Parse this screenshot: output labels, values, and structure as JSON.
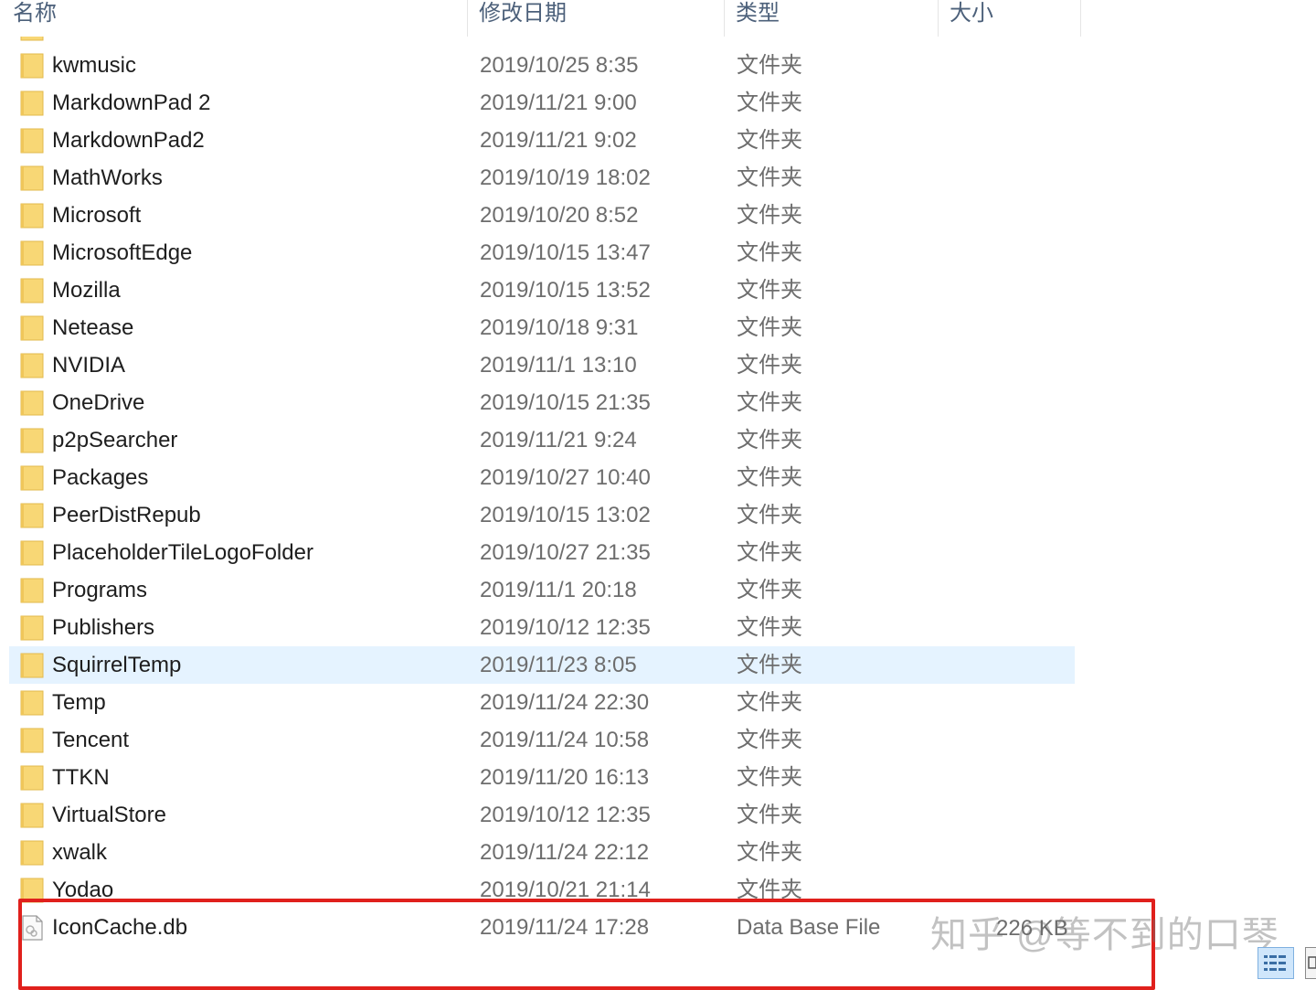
{
  "columns": {
    "name": "名称",
    "date": "修改日期",
    "type": "类型",
    "size": "大小"
  },
  "rows": [
    {
      "name": "kwmusic",
      "date": "2019/10/25 8:35",
      "type": "文件夹",
      "icon": "folder-icon"
    },
    {
      "name": "MarkdownPad 2",
      "date": "2019/11/21 9:00",
      "type": "文件夹",
      "icon": "folder-icon"
    },
    {
      "name": "MarkdownPad2",
      "date": "2019/11/21 9:02",
      "type": "文件夹",
      "icon": "folder-icon"
    },
    {
      "name": "MathWorks",
      "date": "2019/10/19 18:02",
      "type": "文件夹",
      "icon": "folder-icon"
    },
    {
      "name": "Microsoft",
      "date": "2019/10/20 8:52",
      "type": "文件夹",
      "icon": "folder-icon"
    },
    {
      "name": "MicrosoftEdge",
      "date": "2019/10/15 13:47",
      "type": "文件夹",
      "icon": "folder-icon"
    },
    {
      "name": "Mozilla",
      "date": "2019/10/15 13:52",
      "type": "文件夹",
      "icon": "folder-icon"
    },
    {
      "name": "Netease",
      "date": "2019/10/18 9:31",
      "type": "文件夹",
      "icon": "folder-icon"
    },
    {
      "name": "NVIDIA",
      "date": "2019/11/1 13:10",
      "type": "文件夹",
      "icon": "folder-icon"
    },
    {
      "name": "OneDrive",
      "date": "2019/10/15 21:35",
      "type": "文件夹",
      "icon": "folder-icon"
    },
    {
      "name": "p2pSearcher",
      "date": "2019/11/21 9:24",
      "type": "文件夹",
      "icon": "folder-icon"
    },
    {
      "name": "Packages",
      "date": "2019/10/27 10:40",
      "type": "文件夹",
      "icon": "folder-icon"
    },
    {
      "name": "PeerDistRepub",
      "date": "2019/10/15 13:02",
      "type": "文件夹",
      "icon": "folder-icon"
    },
    {
      "name": "PlaceholderTileLogoFolder",
      "date": "2019/10/27 21:35",
      "type": "文件夹",
      "icon": "folder-icon"
    },
    {
      "name": "Programs",
      "date": "2019/11/1 20:18",
      "type": "文件夹",
      "icon": "folder-icon"
    },
    {
      "name": "Publishers",
      "date": "2019/10/12 12:35",
      "type": "文件夹",
      "icon": "folder-icon"
    },
    {
      "name": "SquirrelTemp",
      "date": "2019/11/23 8:05",
      "type": "文件夹",
      "icon": "folder-icon",
      "selected": true
    },
    {
      "name": "Temp",
      "date": "2019/11/24 22:30",
      "type": "文件夹",
      "icon": "folder-icon"
    },
    {
      "name": "Tencent",
      "date": "2019/11/24 10:58",
      "type": "文件夹",
      "icon": "folder-icon"
    },
    {
      "name": "TTKN",
      "date": "2019/11/20 16:13",
      "type": "文件夹",
      "icon": "folder-icon"
    },
    {
      "name": "VirtualStore",
      "date": "2019/10/12 12:35",
      "type": "文件夹",
      "icon": "folder-icon"
    },
    {
      "name": "xwalk",
      "date": "2019/11/24 22:12",
      "type": "文件夹",
      "icon": "folder-icon"
    },
    {
      "name": "Yodao",
      "date": "2019/10/21 21:14",
      "type": "文件夹",
      "icon": "folder-icon"
    },
    {
      "name": "IconCache.db",
      "date": "2019/11/24 17:28",
      "type": "Data Base File",
      "size": "226 KB",
      "icon": "db-file-icon"
    }
  ],
  "watermark": "知乎 @等不到的口琴",
  "colors": {
    "selected_row": "#e5f3ff",
    "highlight_border": "#e0201c",
    "folder": "#f8d775",
    "header_text": "#4c607a"
  }
}
